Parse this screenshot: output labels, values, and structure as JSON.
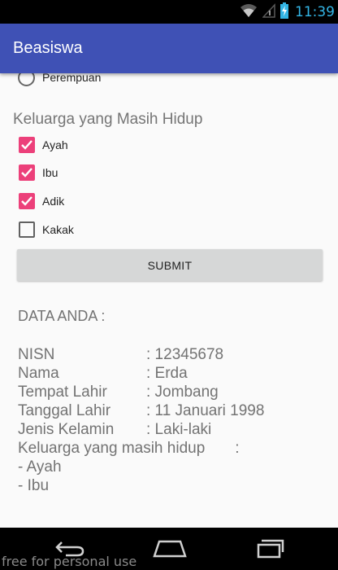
{
  "status_bar": {
    "time": "11:39",
    "icons": [
      "wifi-icon",
      "signal-icon",
      "battery-icon"
    ]
  },
  "app_bar": {
    "title": "Beasiswa"
  },
  "gender": {
    "option_label": "Perempuan",
    "selected": false
  },
  "family_section": {
    "title": "Keluarga yang Masih Hidup",
    "options": [
      {
        "label": "Ayah",
        "checked": true
      },
      {
        "label": "Ibu",
        "checked": true
      },
      {
        "label": "Adik",
        "checked": true
      },
      {
        "label": "Kakak",
        "checked": false
      }
    ]
  },
  "submit_label": "SUBMIT",
  "result": {
    "title": "DATA ANDA :",
    "rows": [
      {
        "label": "NISN",
        "value": ": 12345678"
      },
      {
        "label": "Nama",
        "value": ": Erda"
      },
      {
        "label": "Tempat Lahir",
        "value": ": Jombang"
      },
      {
        "label": "Tanggal Lahir",
        "value": ": 11 Januari 1998"
      },
      {
        "label": "Jenis Kelamin",
        "value": ": Laki-laki"
      }
    ],
    "family_label": "Keluarga yang masih hidup",
    "family_colon": ":",
    "family_items": [
      "- Ayah",
      "- Ibu"
    ]
  },
  "nav_bar": {
    "buttons": [
      "back-icon",
      "home-icon",
      "recents-icon"
    ]
  },
  "watermark": "free for personal use",
  "colors": {
    "app_bar": "#3f51b5",
    "accent": "#ec407a",
    "status_time": "#33b5e5"
  }
}
